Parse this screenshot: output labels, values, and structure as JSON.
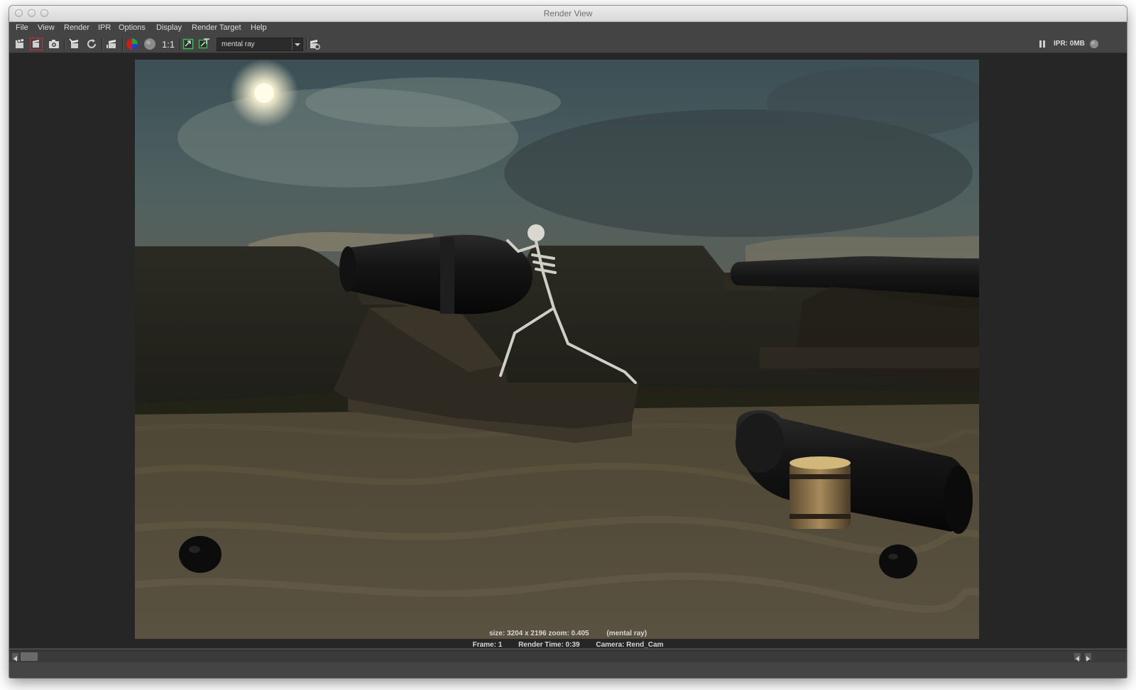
{
  "window": {
    "title": "Render View"
  },
  "menu": [
    "File",
    "View",
    "Render",
    "IPR",
    "Options",
    "Display",
    "Render Target",
    "Help"
  ],
  "toolbar": {
    "ratio_label": "1:1",
    "renderer": "mental ray",
    "ipr_status": "IPR: 0MB"
  },
  "status": {
    "size_line": "size: 3204 x 2196 zoom: 0.405",
    "renderer_tag": "(mental ray)",
    "frame": "Frame: 1",
    "render_time": "Render Time: 0:39",
    "camera": "Camera: Rend_Cam"
  }
}
